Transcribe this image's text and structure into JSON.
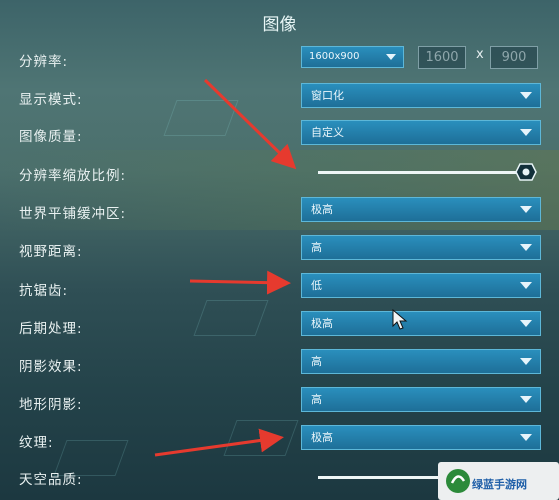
{
  "title": "图像",
  "resolution": {
    "label": "分辨率:",
    "value": "1600x900",
    "width": "1600",
    "times": "x",
    "height": "900"
  },
  "rows": [
    {
      "label": "显示模式:",
      "value": "窗口化"
    },
    {
      "label": "图像质量:",
      "value": "自定义"
    },
    {
      "label": "分辨率缩放比例:",
      "slider": 1.0
    },
    {
      "label": "世界平铺缓冲区:",
      "value": "极高"
    },
    {
      "label": "视野距离:",
      "value": "高"
    },
    {
      "label": "抗锯齿:",
      "value": "低"
    },
    {
      "label": "后期处理:",
      "value": "极高"
    },
    {
      "label": "阴影效果:",
      "value": "高"
    },
    {
      "label": "地形阴影:",
      "value": "高"
    },
    {
      "label": "纹理:",
      "value": "极高"
    },
    {
      "label": "天空品质:"
    }
  ],
  "watermark": "绿蓝手游网",
  "accent": "#1e6f98",
  "arrow_color": "#e63a2e"
}
